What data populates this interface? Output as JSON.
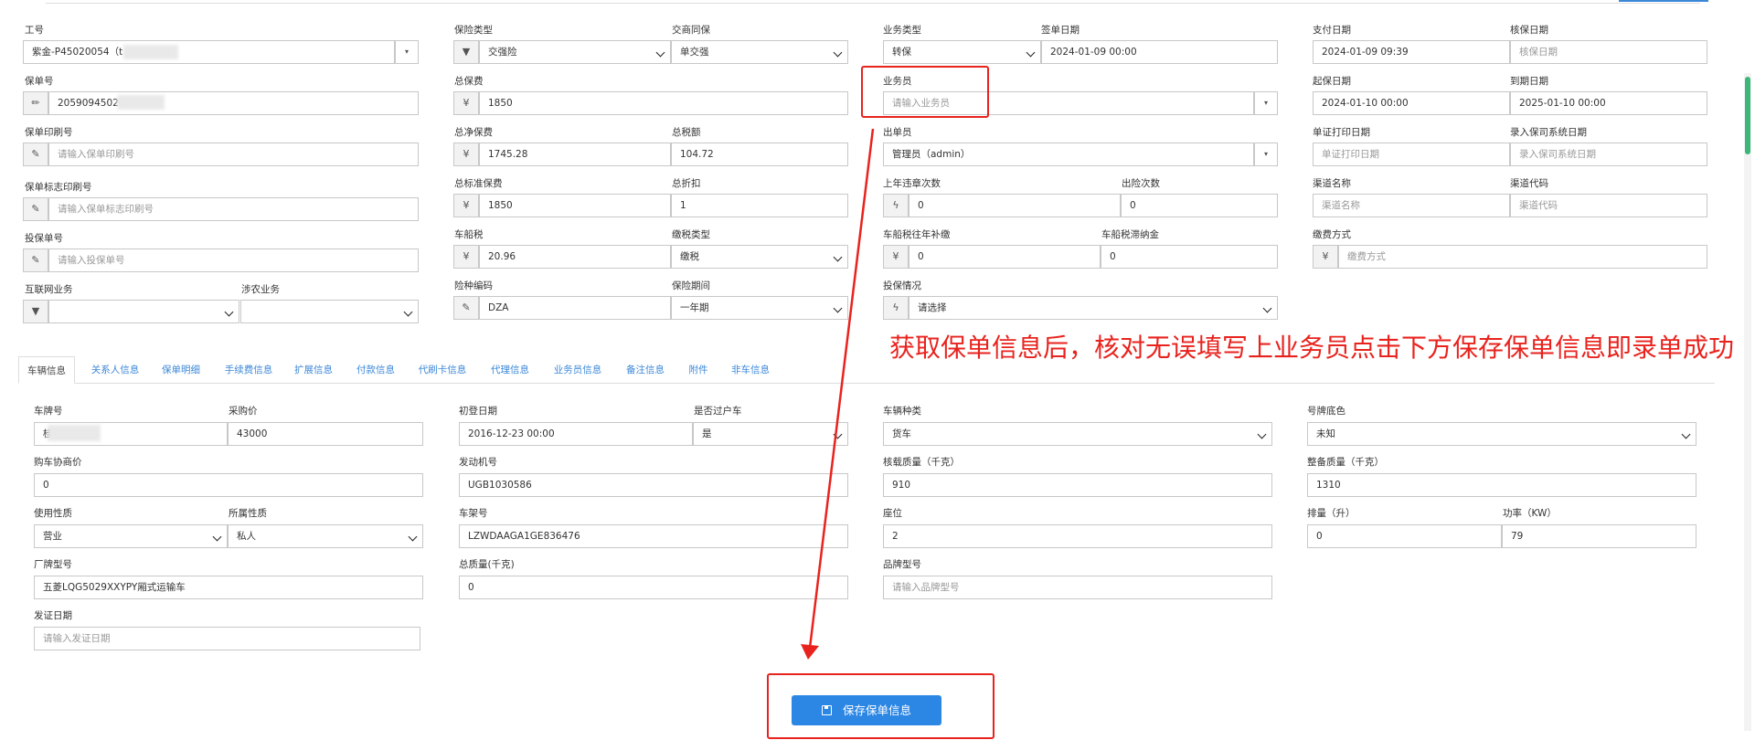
{
  "top": {
    "gonghao": {
      "label": "工号",
      "value": "紫金-P45020054（t"
    },
    "baodanhao": {
      "label": "保单号",
      "value": "20590945020"
    },
    "baodan_yinshua": {
      "label": "保单印刷号",
      "placeholder": "请输入保单印刷号"
    },
    "biaozhi_yinshua": {
      "label": "保单标志印刷号",
      "placeholder": "请输入保单标志印刷号"
    },
    "toubaodanhao": {
      "label": "投保单号",
      "placeholder": "请输入投保单号"
    },
    "hulianwang": {
      "label": "互联网业务",
      "value": ""
    },
    "shenong": {
      "label": "涉农业务",
      "value": ""
    },
    "xianzhong_type": {
      "label": "保险类型",
      "value": "交强险"
    },
    "jiaoshang": {
      "label": "交商同保",
      "value": "单交强"
    },
    "total_premium": {
      "label": "总保费",
      "value": "1850"
    },
    "net_premium": {
      "label": "总净保费",
      "value": "1745.28"
    },
    "total_tax": {
      "label": "总税额",
      "value": "104.72"
    },
    "std_premium": {
      "label": "总标准保费",
      "value": "1850"
    },
    "discount": {
      "label": "总折扣",
      "value": "1"
    },
    "vessel_tax": {
      "label": "车船税",
      "value": "20.96"
    },
    "tax_type": {
      "label": "缴税类型",
      "value": "缴税"
    },
    "xz_code": {
      "label": "险种编码",
      "value": "DZA"
    },
    "period": {
      "label": "保险期间",
      "value": "一年期"
    },
    "biz_type": {
      "label": "业务类型",
      "value": "转保"
    },
    "sign_date": {
      "label": "签单日期",
      "value": "2024-01-09 00:00"
    },
    "salesman": {
      "label": "业务员",
      "placeholder": "请输入业务员"
    },
    "issuer": {
      "label": "出单员",
      "value": "管理员（admin）"
    },
    "violations": {
      "label": "上年违章次数",
      "value": "0"
    },
    "claims": {
      "label": "出险次数",
      "value": "0"
    },
    "tax_back": {
      "label": "车船税往年补缴",
      "value": "0"
    },
    "tax_late": {
      "label": "车船税滞纳金",
      "value": "0"
    },
    "toubao_status": {
      "label": "投保情况",
      "value": "请选择"
    },
    "pay_date": {
      "label": "支付日期",
      "value": "2024-01-09 09:39"
    },
    "verify_date": {
      "label": "核保日期",
      "placeholder": "核保日期"
    },
    "start_date": {
      "label": "起保日期",
      "value": "2024-01-10 00:00"
    },
    "end_date": {
      "label": "到期日期",
      "value": "2025-01-10 00:00"
    },
    "print_date": {
      "label": "单证打印日期",
      "placeholder": "单证打印日期"
    },
    "entry_date": {
      "label": "录入保司系统日期",
      "placeholder": "录入保司系统日期"
    },
    "channel_name": {
      "label": "渠道名称",
      "placeholder": "渠道名称"
    },
    "channel_code": {
      "label": "渠道代码",
      "placeholder": "渠道代码"
    },
    "pay_method": {
      "label": "缴费方式",
      "placeholder": "缴费方式"
    }
  },
  "tabs": [
    "车辆信息",
    "关系人信息",
    "保单明细",
    "手续费信息",
    "扩展信息",
    "付款信息",
    "代刷卡信息",
    "代理信息",
    "业务员信息",
    "备注信息",
    "附件",
    "非车信息"
  ],
  "vehicle": {
    "plate": {
      "label": "车牌号",
      "value": "桂"
    },
    "purchase_price": {
      "label": "采购价",
      "value": "43000"
    },
    "nego_price": {
      "label": "购车协商价",
      "value": "0"
    },
    "use_type": {
      "label": "使用性质",
      "value": "营业"
    },
    "owner_type": {
      "label": "所属性质",
      "value": "私人"
    },
    "brand_model": {
      "label": "厂牌型号",
      "value": "五菱LQG5029XXYPY厢式运输车"
    },
    "cert_date": {
      "label": "发证日期",
      "placeholder": "请输入发证日期"
    },
    "first_reg": {
      "label": "初登日期",
      "value": "2016-12-23 00:00"
    },
    "transfer": {
      "label": "是否过户车",
      "value": "是"
    },
    "engine_no": {
      "label": "发动机号",
      "value": "UGB1030586"
    },
    "vin": {
      "label": "车架号",
      "value": "LZWDAAGA1GE836476"
    },
    "gross_mass": {
      "label": "总质量(千克)",
      "value": "0"
    },
    "vehicle_kind": {
      "label": "车辆种类",
      "value": "货车"
    },
    "load_mass": {
      "label": "核载质量（千克）",
      "value": "910"
    },
    "seats": {
      "label": "座位",
      "value": "2"
    },
    "brand_no": {
      "label": "品牌型号",
      "placeholder": "请输入品牌型号"
    },
    "plate_color": {
      "label": "号牌底色",
      "value": "未知"
    },
    "curb_mass": {
      "label": "整备质量（千克）",
      "value": "1310"
    },
    "displacement": {
      "label": "排量（升）",
      "value": "0"
    },
    "power": {
      "label": "功率（KW）",
      "value": "79"
    }
  },
  "annotation": "获取保单信息后，核对无误填写上业务员点击下方保存保单信息即录单成功",
  "save_button": "保存保单信息",
  "icons": {
    "yen": "¥",
    "edit": "✎",
    "filter": "▼",
    "bolt": "ϟ",
    "pencil": "✏",
    "caret": "▾"
  },
  "colors": {
    "accent": "#2b86e4",
    "annotation": "#e8231e",
    "scrollbar": "#3bb879"
  }
}
